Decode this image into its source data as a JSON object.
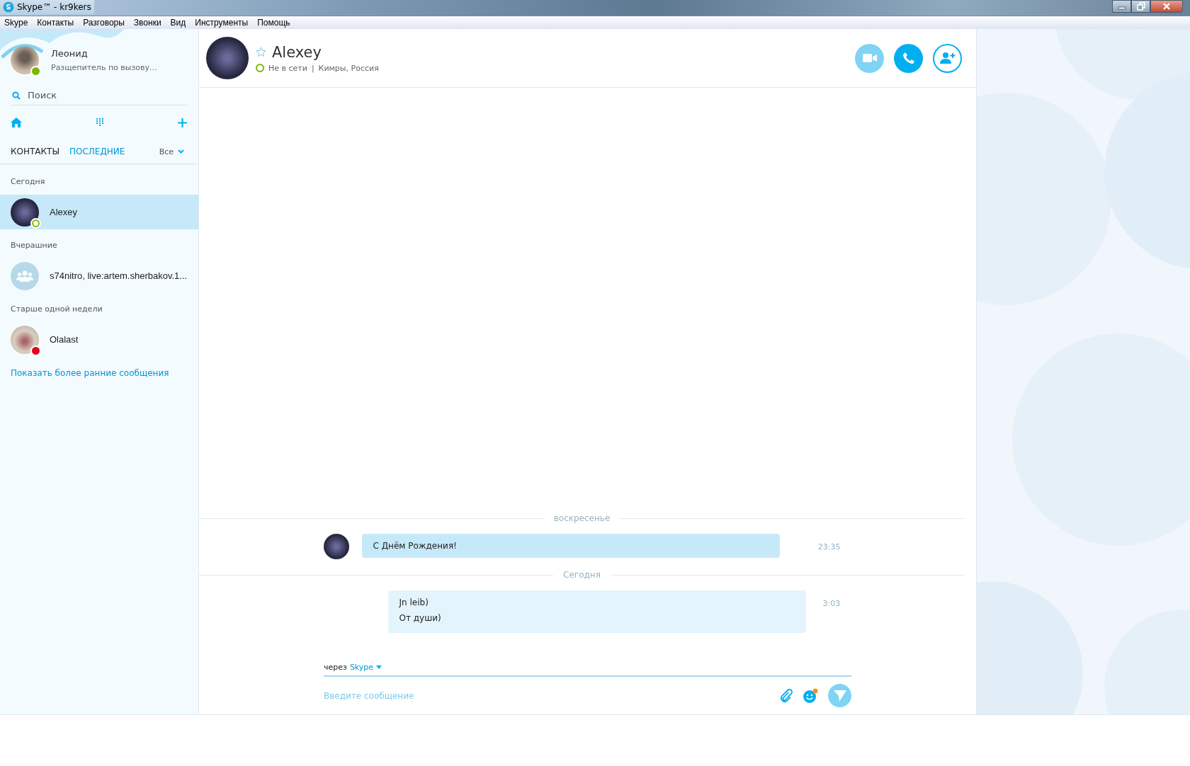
{
  "window": {
    "title": "Skype™ - kr9kers"
  },
  "menu": [
    "Skype",
    "Контакты",
    "Разговоры",
    "Звонки",
    "Вид",
    "Инструменты",
    "Помощь"
  ],
  "profile": {
    "name": "Леонид",
    "mood": "Разщепитель по вызову...",
    "status": {
      "kind": "online"
    }
  },
  "search": {
    "placeholder": "Поиск"
  },
  "tabs": [
    {
      "label": "КОНТАКТЫ",
      "selected": false
    },
    {
      "label": "ПОСЛЕДНИЕ",
      "selected": true
    }
  ],
  "filter": "Все",
  "groups": [
    {
      "heading": "Сегодня",
      "items": [
        {
          "kind": "contact",
          "name": "Alexey",
          "status": {
            "kind": "offline"
          },
          "selected": true
        }
      ]
    },
    {
      "heading": "Вчерашние",
      "items": [
        {
          "kind": "group",
          "name": "s74nitro, live:artem.sherbakov.1...",
          "selected": false
        }
      ]
    },
    {
      "heading": "Старше одной недели",
      "items": [
        {
          "kind": "contact",
          "name": "Olalast",
          "status": {
            "kind": "dnd"
          },
          "selected": false
        }
      ]
    }
  ],
  "show_earlier": "Показать более ранние сообщения",
  "conversation": {
    "name": "Alexey",
    "favorite": false,
    "status": {
      "kind": "offline"
    },
    "status_text": "Не в сети",
    "divider": "|",
    "location": "Кимры, Россия"
  },
  "messages": [
    {
      "kind": "separator",
      "label": "воскресенье"
    },
    {
      "kind": "incoming",
      "lines": [
        "С Днём Рождения!"
      ],
      "time": "23:35"
    },
    {
      "kind": "separator",
      "label": "Сегодня"
    },
    {
      "kind": "outgoing",
      "lines": [
        "Jn leib)",
        "От души)"
      ],
      "time": "3:03"
    }
  ],
  "composer": {
    "via_label": "через",
    "via_service": "Skype",
    "placeholder": "Введите сообщение"
  }
}
